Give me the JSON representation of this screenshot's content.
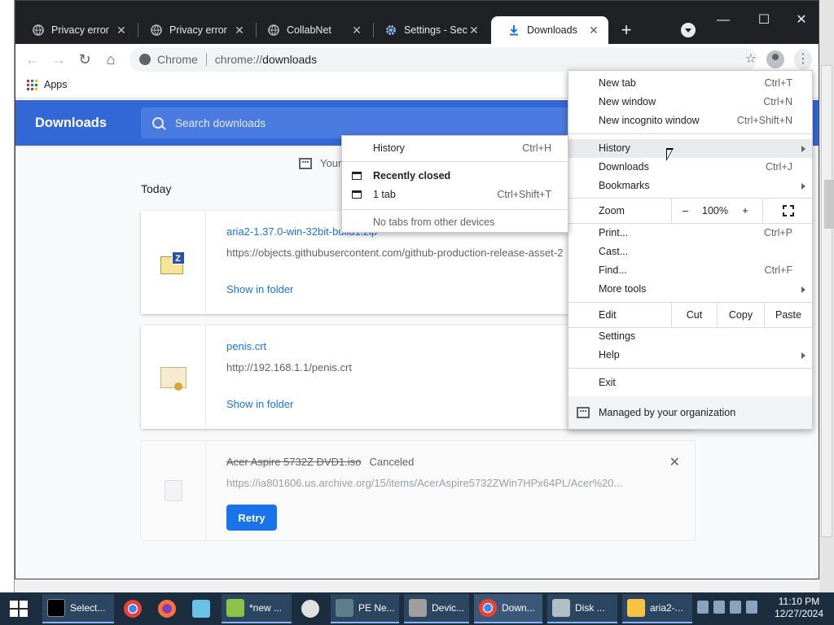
{
  "browser": {
    "tabs": [
      {
        "label": "Privacy error",
        "icon": "globe-icon",
        "active": false
      },
      {
        "label": "Privacy error",
        "icon": "globe-icon",
        "active": false
      },
      {
        "label": "CollabNet",
        "icon": "globe-icon",
        "active": false
      },
      {
        "label": "Settings - Secu",
        "icon": "gear-icon",
        "active": false
      },
      {
        "label": "Downloads",
        "icon": "download-icon",
        "active": true
      }
    ],
    "omnibox": {
      "origin": "Chrome",
      "scheme": "chrome://",
      "path": "downloads"
    },
    "bookmarks": {
      "apps_label": "Apps"
    }
  },
  "downloads_page": {
    "title": "Downloads",
    "search_placeholder": "Search downloads",
    "managed_notice": "Your",
    "section_label": "Today",
    "items": [
      {
        "filename": "aria2-1.37.0-win-32bit-build1.zip",
        "url": "https://objects.githubusercontent.com/github-production-release-asset-2",
        "action": "Show in folder",
        "icon": "zip-folder-icon"
      },
      {
        "filename": "penis.crt",
        "url": "http://192.168.1.1/penis.crt",
        "action": "Show in folder",
        "icon": "certificate-icon"
      },
      {
        "filename": "Acer Aspire 5732Z DVD1.iso",
        "status": "Canceled",
        "url": "https://ia801606.us.archive.org/15/items/AcerAspire5732ZWin7HPx64PL/Acer%20...",
        "action": "Retry",
        "icon": "blank-file-icon"
      }
    ]
  },
  "main_menu": {
    "new_tab": {
      "label": "New tab",
      "shortcut": "Ctrl+T"
    },
    "new_window": {
      "label": "New window",
      "shortcut": "Ctrl+N"
    },
    "new_incognito": {
      "label": "New incognito window",
      "shortcut": "Ctrl+Shift+N"
    },
    "history": {
      "label": "History"
    },
    "downloads": {
      "label": "Downloads",
      "shortcut": "Ctrl+J"
    },
    "bookmarks": {
      "label": "Bookmarks"
    },
    "zoom": {
      "label": "Zoom",
      "minus": "–",
      "value": "100%",
      "plus": "+"
    },
    "print": {
      "label": "Print...",
      "shortcut": "Ctrl+P"
    },
    "cast": {
      "label": "Cast..."
    },
    "find": {
      "label": "Find...",
      "shortcut": "Ctrl+F"
    },
    "more_tools": {
      "label": "More tools"
    },
    "edit": {
      "label": "Edit",
      "cut": "Cut",
      "copy": "Copy",
      "paste": "Paste"
    },
    "settings": {
      "label": "Settings"
    },
    "help": {
      "label": "Help"
    },
    "exit": {
      "label": "Exit"
    },
    "managed": {
      "label": "Managed by your organization"
    }
  },
  "history_submenu": {
    "history": {
      "label": "History",
      "shortcut": "Ctrl+H"
    },
    "recently_closed": "Recently closed",
    "one_tab": {
      "label": "1 tab",
      "shortcut": "Ctrl+Shift+T"
    },
    "no_tabs": "No tabs from other devices"
  },
  "taskbar": {
    "items": [
      {
        "label": "Select...",
        "icon": "cmd-icon"
      },
      {
        "label": "",
        "icon": "chrome-icon"
      },
      {
        "label": "",
        "icon": "firefox-icon"
      },
      {
        "label": "",
        "icon": "notepad-icon"
      },
      {
        "label": "*new ...",
        "icon": "notepadpp-icon"
      },
      {
        "label": "",
        "icon": "paint-icon"
      },
      {
        "label": "PE Ne...",
        "icon": "pe-icon"
      },
      {
        "label": "Devic...",
        "icon": "device-manager-icon"
      },
      {
        "label": "Down...",
        "icon": "chrome-icon"
      },
      {
        "label": "Disk ...",
        "icon": "disk-icon"
      },
      {
        "label": "aria2-...",
        "icon": "folder-icon"
      }
    ],
    "time": "11:10 PM",
    "date": "12/27/2024"
  },
  "colors": {
    "accent": "#3367d6",
    "link": "#1a73e8",
    "tabbar": "#202124",
    "taskbar": "#1c2d3f"
  }
}
